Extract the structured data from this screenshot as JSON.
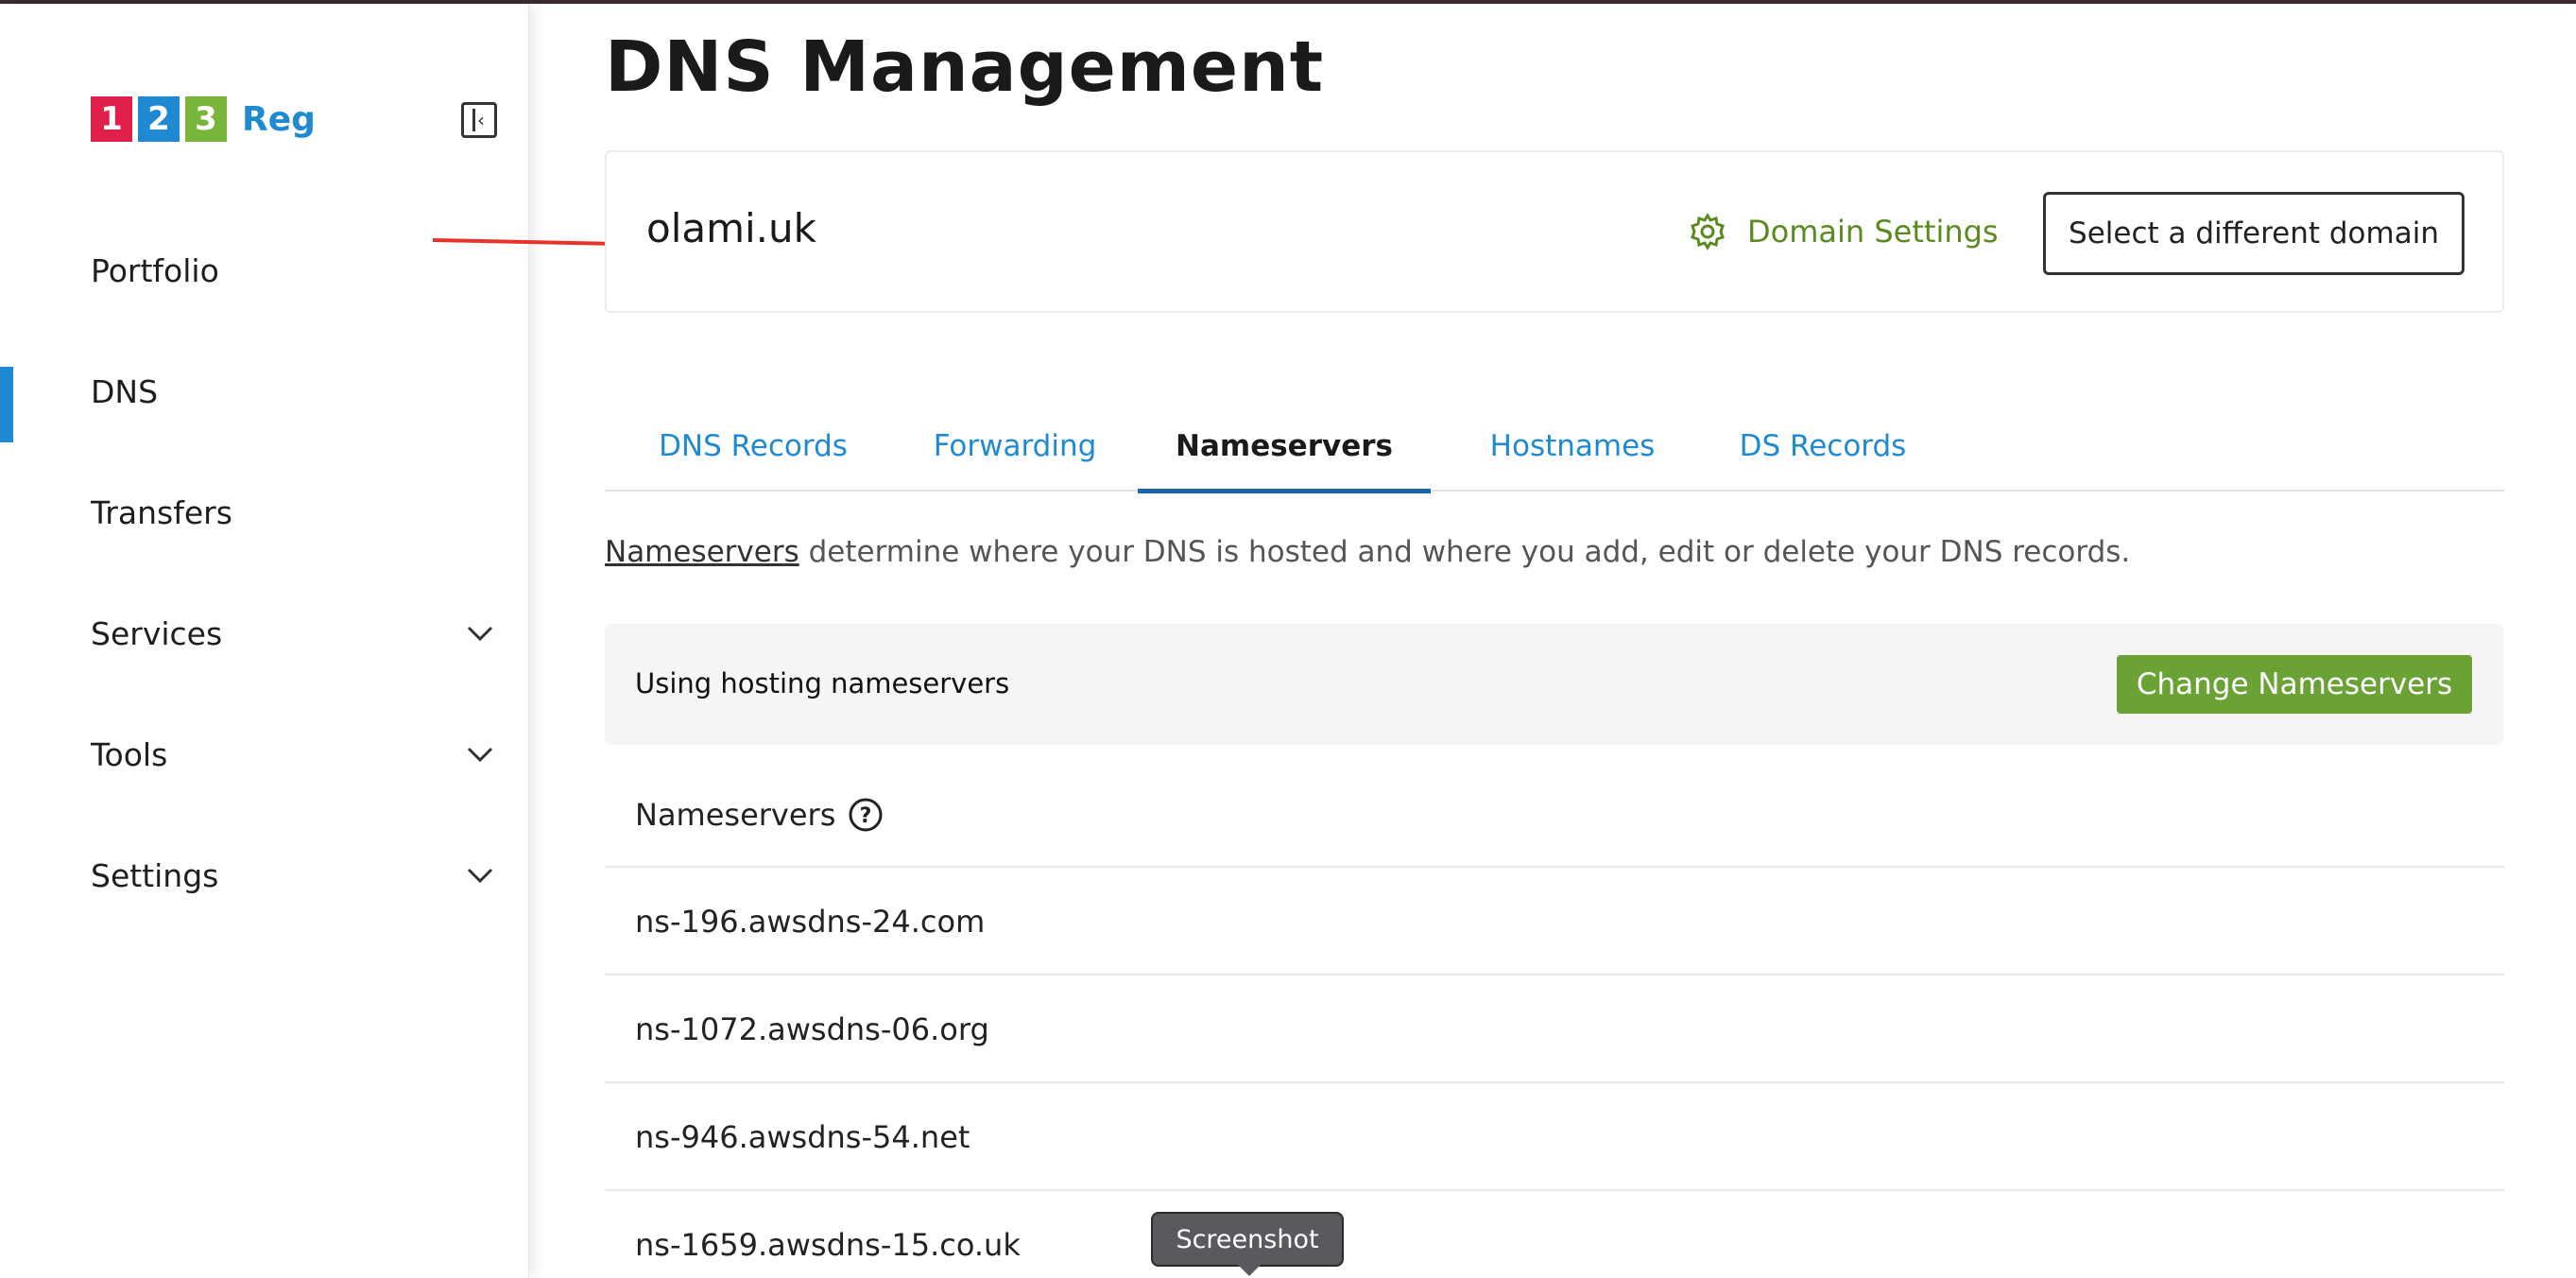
{
  "brand": {
    "digits": [
      "1",
      "2",
      "3"
    ],
    "digit_colors": [
      "#e0204a",
      "#1f8ad2",
      "#7ab53b"
    ],
    "name": "Reg",
    "name_color": "#1f8ad2"
  },
  "sidebar": {
    "collapse_icon": "sidebar-collapse-icon",
    "items": [
      {
        "label": "Portfolio",
        "active": false,
        "expandable": false
      },
      {
        "label": "DNS",
        "active": true,
        "expandable": false
      },
      {
        "label": "Transfers",
        "active": false,
        "expandable": false
      },
      {
        "label": "Services",
        "active": false,
        "expandable": true
      },
      {
        "label": "Tools",
        "active": false,
        "expandable": true
      },
      {
        "label": "Settings",
        "active": false,
        "expandable": true
      }
    ],
    "active_color": "#1f8ad2"
  },
  "page": {
    "title": "DNS Management"
  },
  "domain_card": {
    "domain": "olami.uk",
    "settings_label": "Domain Settings",
    "select_label": "Select a different domain",
    "accent_color": "#5b8a1f"
  },
  "tabs": [
    {
      "label": "DNS Records",
      "active": false
    },
    {
      "label": "Forwarding",
      "active": false
    },
    {
      "label": "Nameservers",
      "active": true
    },
    {
      "label": "Hostnames",
      "active": false
    },
    {
      "label": "DS Records",
      "active": false
    }
  ],
  "description": {
    "link_text": "Nameservers",
    "rest": " determine where your DNS is hosted and where you add, edit or delete your DNS records."
  },
  "status": {
    "text": "Using hosting nameservers",
    "button_label": "Change Nameservers",
    "button_color": "#6aa235"
  },
  "nameservers": {
    "header": "Nameservers",
    "list": [
      "ns-196.awsdns-24.com",
      "ns-1072.awsdns-06.org",
      "ns-946.awsdns-54.net",
      "ns-1659.awsdns-15.co.uk"
    ]
  },
  "tooltip": {
    "label": "Screenshot"
  },
  "annotation": {
    "color": "#e8332a",
    "icon": "red-arrow-icon"
  }
}
